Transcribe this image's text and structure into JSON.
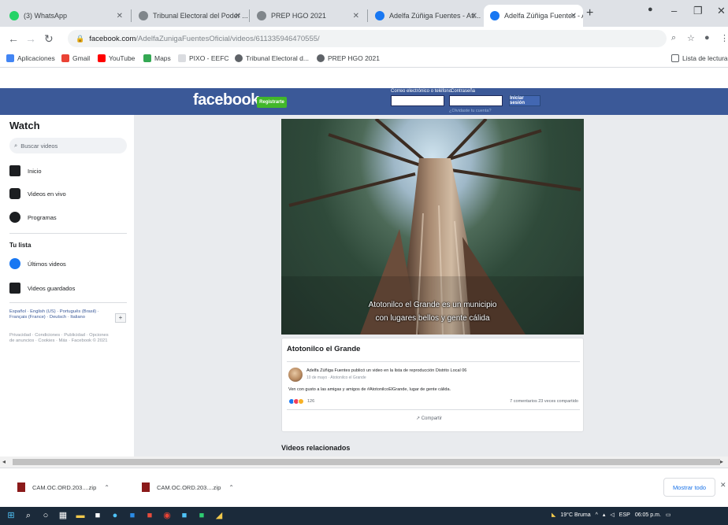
{
  "browser": {
    "tabs": [
      {
        "title": "(3) WhatsApp",
        "favicon_color": "#25d366"
      },
      {
        "title": "Tribunal Electoral del Poder ...",
        "favicon_color": "#5f6368"
      },
      {
        "title": "PREP HGO 2021",
        "favicon_color": "#5f6368"
      },
      {
        "title": "Adelfa Zúñiga Fuentes - Ati...",
        "favicon_color": "#1877f2"
      },
      {
        "title": "Adelfa Zúñiga Fuentes - Ati...",
        "favicon_color": "#1877f2"
      }
    ],
    "new_tab_glyph": "+",
    "url_host": "facebook.com",
    "url_path": "/AdelfaZunigaFuentesOficial/videos/611335946470555/",
    "bookmarks": [
      {
        "label": "Aplicaciones",
        "color": "#4285f4"
      },
      {
        "label": "Gmail",
        "color": "#ea4335"
      },
      {
        "label": "YouTube",
        "color": "#ff0000"
      },
      {
        "label": "Maps",
        "color": "#34a853"
      },
      {
        "label": "PIXO - EEFC",
        "color": "#5f6368"
      },
      {
        "label": "Tribunal Electoral d...",
        "color": "#5f6368"
      },
      {
        "label": "PREP HGO 2021",
        "color": "#5f6368"
      }
    ],
    "reading_list": "Lista de lectura"
  },
  "fb_header": {
    "logo": "facebook",
    "signup": "Registrarte",
    "email_label": "Correo electrónico o teléfono",
    "password_label": "Contraseña",
    "forgot": "¿Olvidaste tu cuenta?",
    "login": "Iniciar sesión"
  },
  "sidebar": {
    "title": "Watch",
    "search_placeholder": "Buscar videos",
    "items": [
      {
        "label": "Inicio"
      },
      {
        "label": "Videos en vivo"
      },
      {
        "label": "Programas"
      }
    ],
    "history_title": "Tu lista",
    "history_items": [
      {
        "label": "Últimos videos"
      },
      {
        "label": "Videos guardados"
      }
    ],
    "languages": "Español · English (US) · Português (Brasil) · Français (France) · Deutsch · Italiano",
    "footer": "Privacidad · Condiciones · Publicidad · Opciones de anuncios · Cookies · Más · Facebook © 2021"
  },
  "video": {
    "caption_line1": "Atotonilco el Grande es un municipio",
    "caption_line2": "con lugares bellos y gente cálida",
    "title": "Atotonilco el Grande",
    "author_line": "Adelfa Zúñiga Fuentes publicó un video en la lista de reproducción Distrito Local 06",
    "meta": "10 de mayo · Atotonilco el Grande",
    "post_text": "Ven con gusto a las amigas y amigos de #AtotonilcoElGrande, lugar de gente cálida.",
    "reactions_count": "126",
    "counts": "7 comentarios  23 veces compartido",
    "share": "Compartir",
    "related_title": "Videos relacionados"
  },
  "downloads": {
    "items": [
      {
        "name": "CAM.OC.ORD.203....zip"
      },
      {
        "name": "CAM.OC.ORD.203....zip"
      }
    ],
    "show_all": "Mostrar todo"
  },
  "taskbar": {
    "weather": "19°C Bruma",
    "lang": "ESP",
    "time": "06:05 p.m."
  }
}
